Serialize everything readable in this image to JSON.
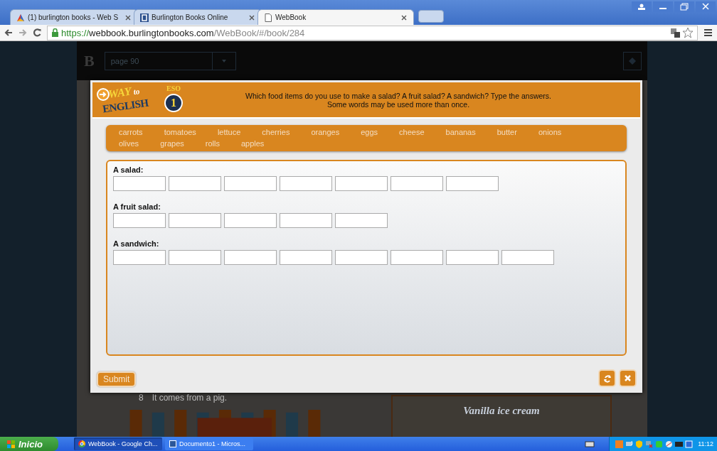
{
  "browser": {
    "tabs": [
      {
        "title": "(1) burlington books - Web S",
        "selected": false
      },
      {
        "title": "Burlington Books Online",
        "selected": false
      },
      {
        "title": "WebBook",
        "selected": true
      }
    ],
    "url": {
      "scheme": "https://",
      "host": "webbook.burlingtonbooks.com",
      "path": "/WebBook/#/book/284"
    }
  },
  "reader": {
    "brand": "B",
    "page_select": "page 90"
  },
  "book_behind": {
    "item_number": "8",
    "item_text": "It comes from a pig.",
    "caption": "Vanilla ice cream"
  },
  "exercise": {
    "logo": {
      "word1": "WAY",
      "word2": "to",
      "word3": "ENGLISH",
      "level_tag": "ESO",
      "level": "1"
    },
    "instruction": [
      "Which food items do you use to make a salad? A fruit salad? A sandwich? Type the answers.",
      "Some words may be used more than once."
    ],
    "word_bank": [
      "carrots",
      "tomatoes",
      "lettuce",
      "cherries",
      "oranges",
      "eggs",
      "cheese",
      "bananas",
      "butter",
      "onions",
      "olives",
      "grapes",
      "rolls",
      "apples"
    ],
    "groups": [
      {
        "label": "A salad:",
        "answers": [
          {
            "kind": "blank"
          },
          {
            "kind": "blank"
          },
          {
            "kind": "blank"
          },
          {
            "kind": "blank"
          },
          {
            "kind": "blank"
          },
          {
            "kind": "blank"
          },
          {
            "kind": "blank"
          }
        ]
      },
      {
        "label": "A fruit salad:",
        "answers": [
          {
            "kind": "blank"
          },
          {
            "kind": "blank"
          },
          {
            "kind": "blank"
          },
          {
            "kind": "blank"
          },
          {
            "kind": "blank"
          }
        ]
      },
      {
        "label": "A sandwich:",
        "answers": [
          {
            "kind": "blank"
          },
          {
            "kind": "blank"
          },
          {
            "kind": "blank"
          },
          {
            "kind": "blank"
          },
          {
            "kind": "blank"
          },
          {
            "kind": "blank"
          },
          {
            "kind": "blank"
          },
          {
            "kind": "blank"
          }
        ]
      }
    ],
    "submit": "Submit"
  },
  "taskbar": {
    "start": "Inicio",
    "items": [
      {
        "title": "WebBook - Google Ch...",
        "selected": true
      },
      {
        "title": "Documento1 - Micros...",
        "selected": false
      }
    ],
    "clock": "11:12"
  }
}
